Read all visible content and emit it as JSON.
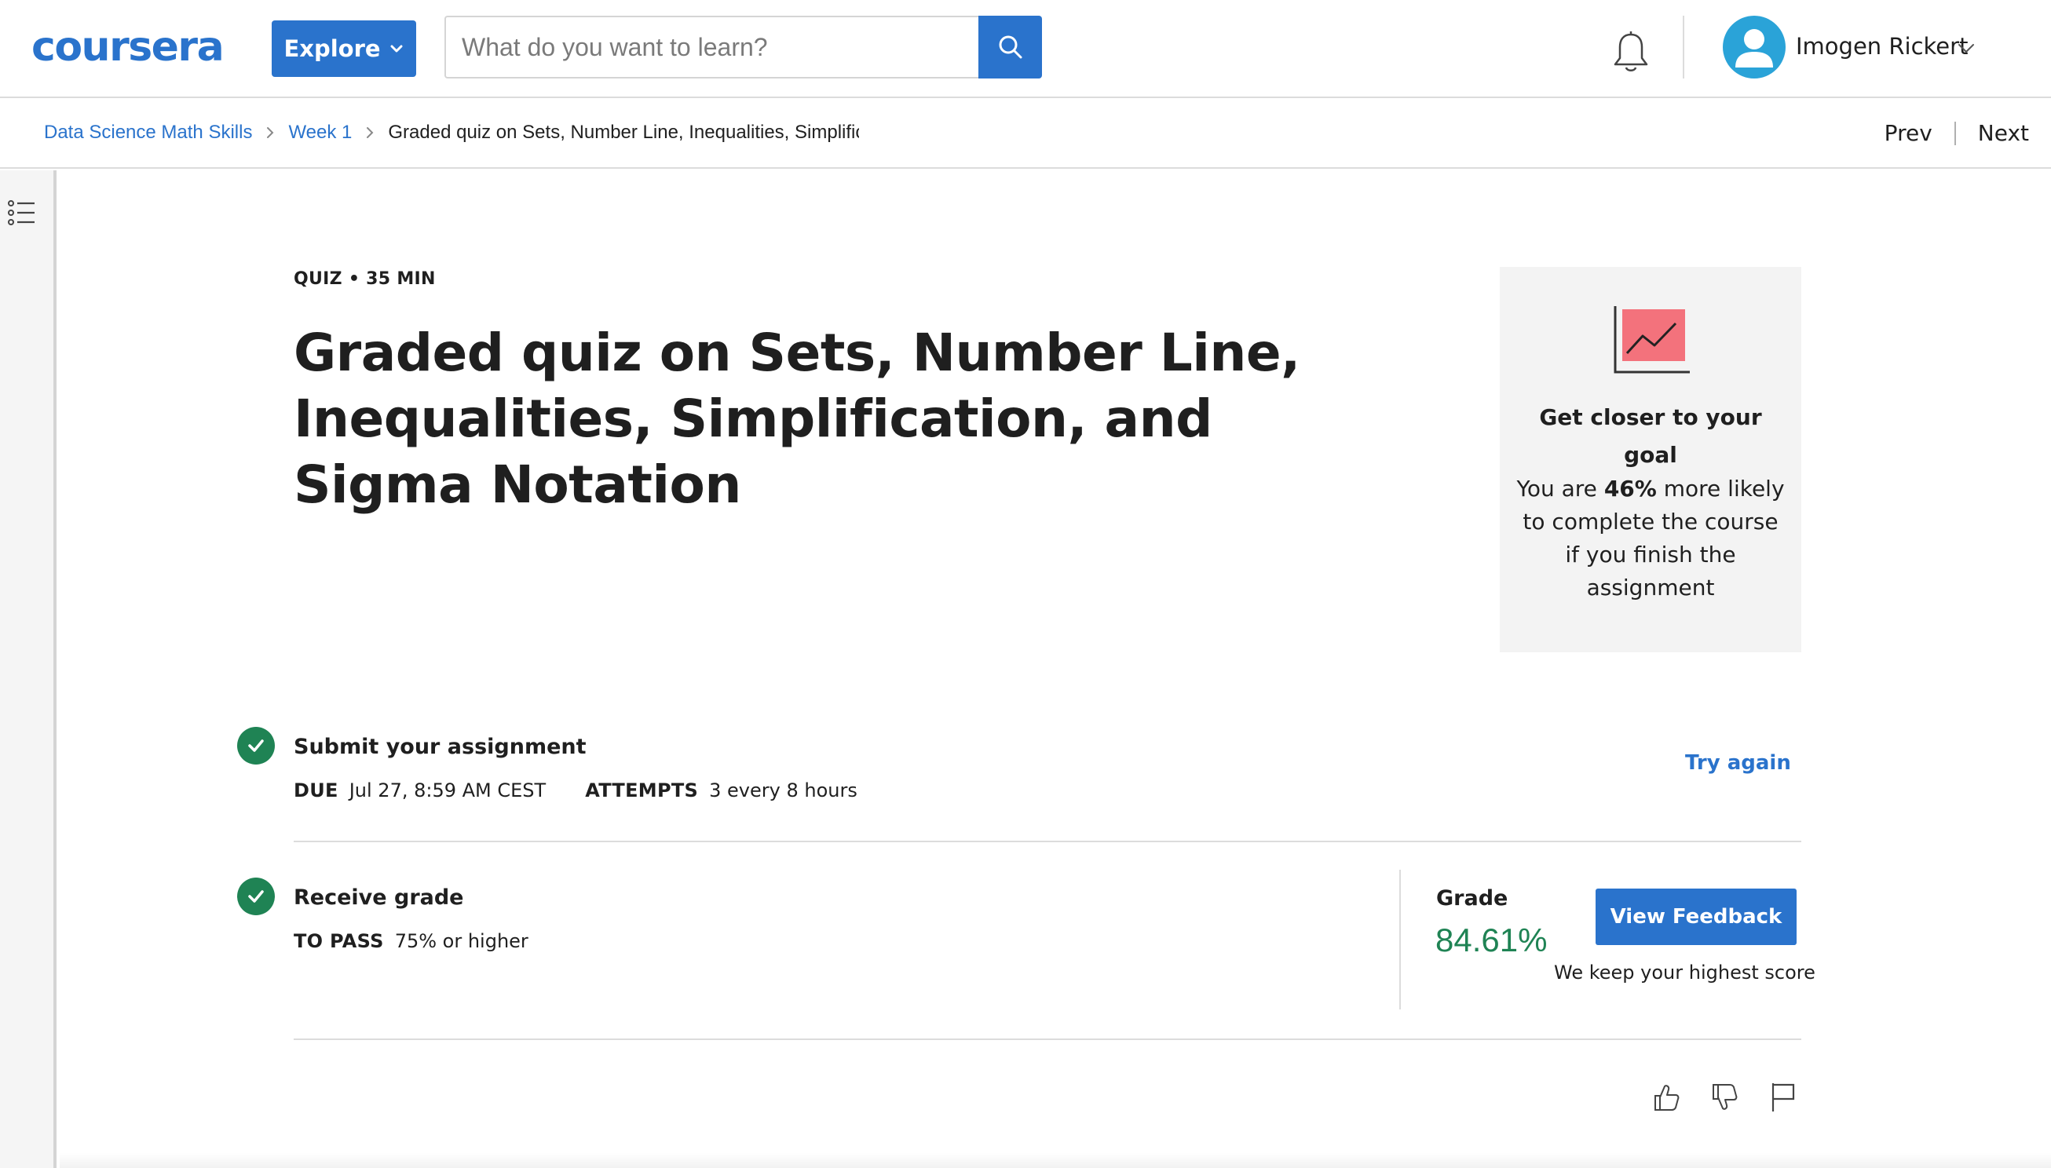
{
  "header": {
    "logo": "coursera",
    "explore_label": "Explore",
    "search_placeholder": "What do you want to learn?",
    "user_name": "Imogen Rickert"
  },
  "breadcrumb": {
    "items": [
      "Data Science Math Skills",
      "Week 1"
    ],
    "current": "Graded quiz on Sets, Number Line, Inequalities, Simplification, and Sigma Notation"
  },
  "pager": {
    "prev": "Prev",
    "next": "Next"
  },
  "quiz": {
    "meta": "QUIZ • 35 MIN",
    "title": "Graded quiz on Sets, Number Line, Inequalities, Simplification, and Sigma Notation"
  },
  "goal_card": {
    "title": "Get closer to your goal",
    "text_before": "You are ",
    "percent": "46%",
    "text_after": " more likely to complete the course if you finish the assignment"
  },
  "submit_step": {
    "title": "Submit your assignment",
    "due_label": "DUE",
    "due_value": "Jul 27, 8:59 AM CEST",
    "attempts_label": "ATTEMPTS",
    "attempts_value": "3 every 8 hours",
    "action": "Try again"
  },
  "grade_step": {
    "title": "Receive grade",
    "to_pass_label": "TO PASS",
    "to_pass_value": "75% or higher",
    "grade_label": "Grade",
    "grade_value": "84.61%",
    "view_feedback": "View Feedback",
    "keep_note": "We keep your highest score"
  },
  "colors": {
    "brand": "#2a73cc",
    "success": "#1f8354",
    "goal_chart": "#f3727c"
  },
  "icons": [
    "search-icon",
    "bell-icon",
    "user-icon",
    "chevron-down-icon",
    "chevron-right-icon",
    "list-icon",
    "chart-icon",
    "checkmark-icon",
    "thumbs-up-icon",
    "thumbs-down-icon",
    "flag-icon"
  ]
}
